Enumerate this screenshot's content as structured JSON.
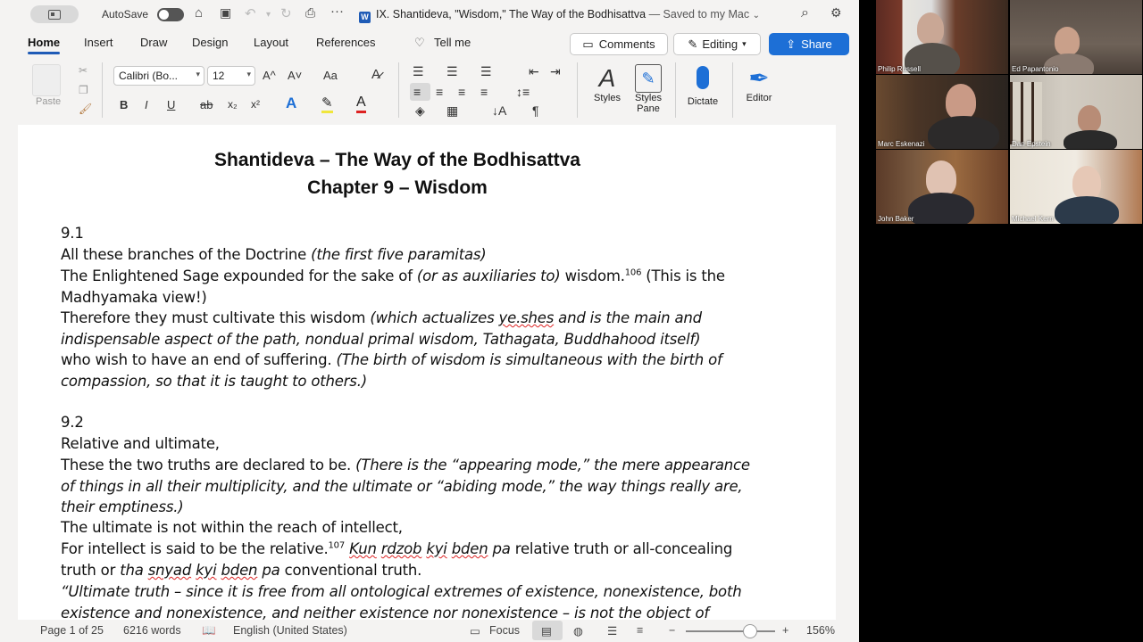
{
  "titlebar": {
    "autosave_label": "AutoSave",
    "doc_title": "IX. Shantideva, \"Wisdom,\" The Way of the Bodhisattva",
    "saved_status": "— Saved to my Mac",
    "word_icon_letter": "W"
  },
  "tabs": [
    "Home",
    "Insert",
    "Draw",
    "Design",
    "Layout",
    "References"
  ],
  "tell_me": "Tell me",
  "actions": {
    "comments": "Comments",
    "editing": "Editing",
    "share": "Share"
  },
  "ribbon": {
    "paste": "Paste",
    "font_name": "Calibri (Bo...",
    "font_size": "12",
    "grow": "A^",
    "shrink": "A˅",
    "case": "Aa",
    "bold": "B",
    "italic": "I",
    "underline": "U",
    "strike": "ab",
    "sub": "x₂",
    "sup": "x²",
    "styles": "Styles",
    "styles_pane": "Styles Pane",
    "dictate": "Dictate",
    "editor": "Editor"
  },
  "document": {
    "title1": "Shantideva – The Way of the Bodhisattva",
    "title2": "Chapter 9 – Wisdom",
    "s1_num": "9.1",
    "l1a": "All these branches of the Doctrine ",
    "l1b": "(the first five paramitas)",
    "l2a": "The Enlightened Sage expounded for the sake of ",
    "l2b": "(or as auxiliaries to)",
    "l2c": " wisdom.",
    "l2sup": "106",
    "l2d": " (This is the",
    "l3": "Madhyamaka view!)",
    "l4a": "Therefore they must cultivate this wisdom ",
    "l4b": "(which actualizes ",
    "l4c": "ye.shes",
    "l4d": " and is the main and",
    "l5": "indispensable aspect of the path, nondual primal wisdom, Tathagata, Buddhahood itself)",
    "l6a": "who wish to have an end of suffering. ",
    "l6b": "(The birth of wisdom is simultaneous with the birth of",
    "l7": "compassion, so that it is taught to others.)",
    "s2_num": "9.2",
    "l8": "Relative and ultimate,",
    "l9a": "These the two truths are declared to be. ",
    "l9b": "(There is the “appearing mode,” the mere appearance",
    "l10": "of things in all their multiplicity, and the ultimate or “abiding mode,” the way things really are,",
    "l11": "their emptiness.)",
    "l12": "The ultimate is not within the reach of intellect,",
    "l13a": "For intellect is said to be the relative.",
    "l13sup": "107",
    "l13b": " ",
    "l13c": "Kun",
    "l13d": " ",
    "l13e": "rdzob",
    "l13f": " ",
    "l13g": "kyi",
    "l13h": " ",
    "l13i": "bden",
    "l13j": " pa",
    "l13k": " relative truth or all-concealing",
    "l14a": "truth or ",
    "l14b": "tha",
    "l14c": " ",
    "l14d": "snyad",
    "l14e": " ",
    "l14f": "kyi",
    "l14g": " ",
    "l14h": "bden",
    "l14i": " pa",
    "l14j": " conventional truth.",
    "l15": "“Ultimate truth – since it is free from all ontological extremes of existence, nonexistence, both",
    "l16": "existence and nonexistence, and neither existence nor nonexistence – is not the object of"
  },
  "status": {
    "page": "Page 1 of 25",
    "words": "6216 words",
    "language": "English (United States)",
    "focus": "Focus",
    "zoom": "156%",
    "zoom_level": 0.72
  },
  "participants": [
    "Philip Russell",
    "Ed Papantonio",
    "Marc Eskenazi",
    "Dan Epstein",
    "John Baker",
    "Michael Kern"
  ],
  "colors": {
    "accent": "#1f5bb6",
    "share": "#1d6fd6"
  }
}
